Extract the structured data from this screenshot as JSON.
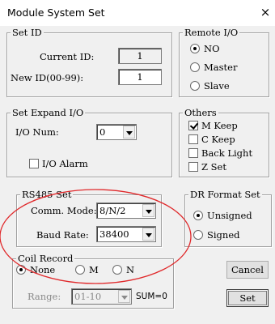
{
  "window": {
    "title": "Module System Set",
    "close_glyph": "×"
  },
  "set_id": {
    "group_title": "Set ID",
    "current_id_label": "Current ID:",
    "current_id_value": "1",
    "new_id_label": "New ID(00-99):",
    "new_id_value": "1"
  },
  "remote_io": {
    "group_title": "Remote I/O",
    "options": [
      "NO",
      "Master",
      "Slave"
    ],
    "selected": "NO"
  },
  "expand_io": {
    "group_title": "Set Expand I/O",
    "io_num_label": "I/O Num:",
    "io_num_value": "0",
    "io_alarm_label": "I/O Alarm",
    "io_alarm_checked": false
  },
  "others": {
    "group_title": "Others",
    "items": [
      {
        "label": "M Keep",
        "checked": true
      },
      {
        "label": "C Keep",
        "checked": false
      },
      {
        "label": "Back Light",
        "checked": false
      },
      {
        "label": "Z Set",
        "checked": false
      }
    ]
  },
  "rs485": {
    "group_title": "RS485 Set",
    "comm_mode_label": "Comm. Mode:",
    "comm_mode_value": "8/N/2",
    "baud_rate_label": "Baud Rate:",
    "baud_rate_value": "38400"
  },
  "dr_format": {
    "group_title": "DR Format Set",
    "options": [
      "Unsigned",
      "Signed"
    ],
    "selected": "Unsigned"
  },
  "coil_record": {
    "group_title": "Coil Record",
    "options": [
      "None",
      "M",
      "N"
    ],
    "selected": "None",
    "range_label": "Range:",
    "range_value": "01-10",
    "sum_text": "SUM=0"
  },
  "buttons": {
    "cancel": "Cancel",
    "set": "Set"
  },
  "colors": {
    "dialog_bg": "#f0f0f0",
    "annotation_ellipse": "#e0282a",
    "group_border": "#a0a0a0"
  }
}
